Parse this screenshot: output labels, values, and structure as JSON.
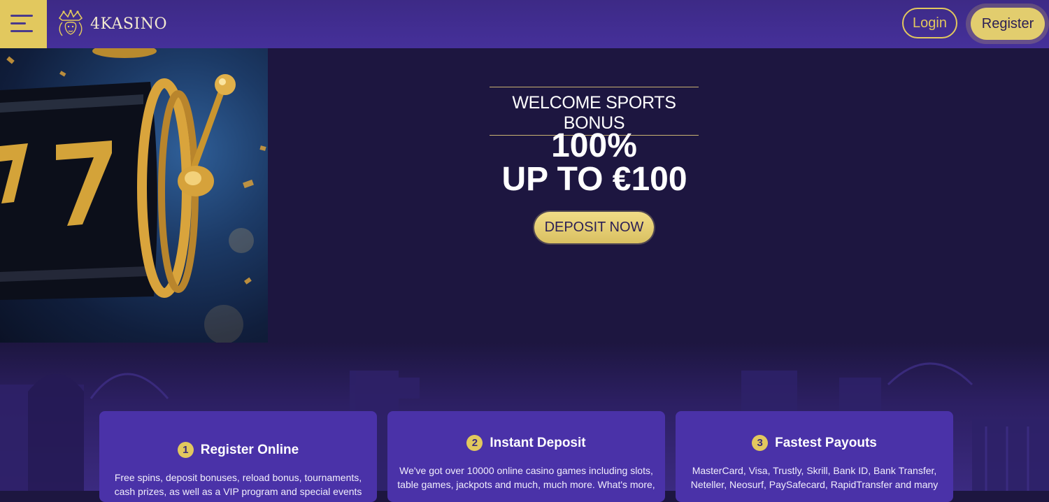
{
  "header": {
    "logo_text": "4KASINO",
    "login_label": "Login",
    "register_label": "Register"
  },
  "hero": {
    "subtitle": "WELCOME SPORTS BONUS",
    "line1": "100%",
    "line2": "UP TO €100",
    "cta_label": "DEPOSIT NOW"
  },
  "features": [
    {
      "number": "1",
      "title": "Register Online",
      "text": "Free spins, deposit bonuses, reload bonus, tournaments, cash prizes, as well as a VIP program and special events"
    },
    {
      "number": "2",
      "title": "Instant Deposit",
      "text": "We've got over 10000 online casino games including slots, table games, jackpots and much, much more. What's more,"
    },
    {
      "number": "3",
      "title": "Fastest Payouts",
      "text": "MasterCard, Visa, Trustly, Skrill, Bank ID, Bank Transfer, Neteller, Neosurf, PaySafecard, RapidTransfer and many"
    }
  ],
  "colors": {
    "accent_gold": "#e2c85e",
    "header_purple": "#412d90",
    "page_dark": "#1d1640",
    "card_purple": "#4a32a8"
  }
}
